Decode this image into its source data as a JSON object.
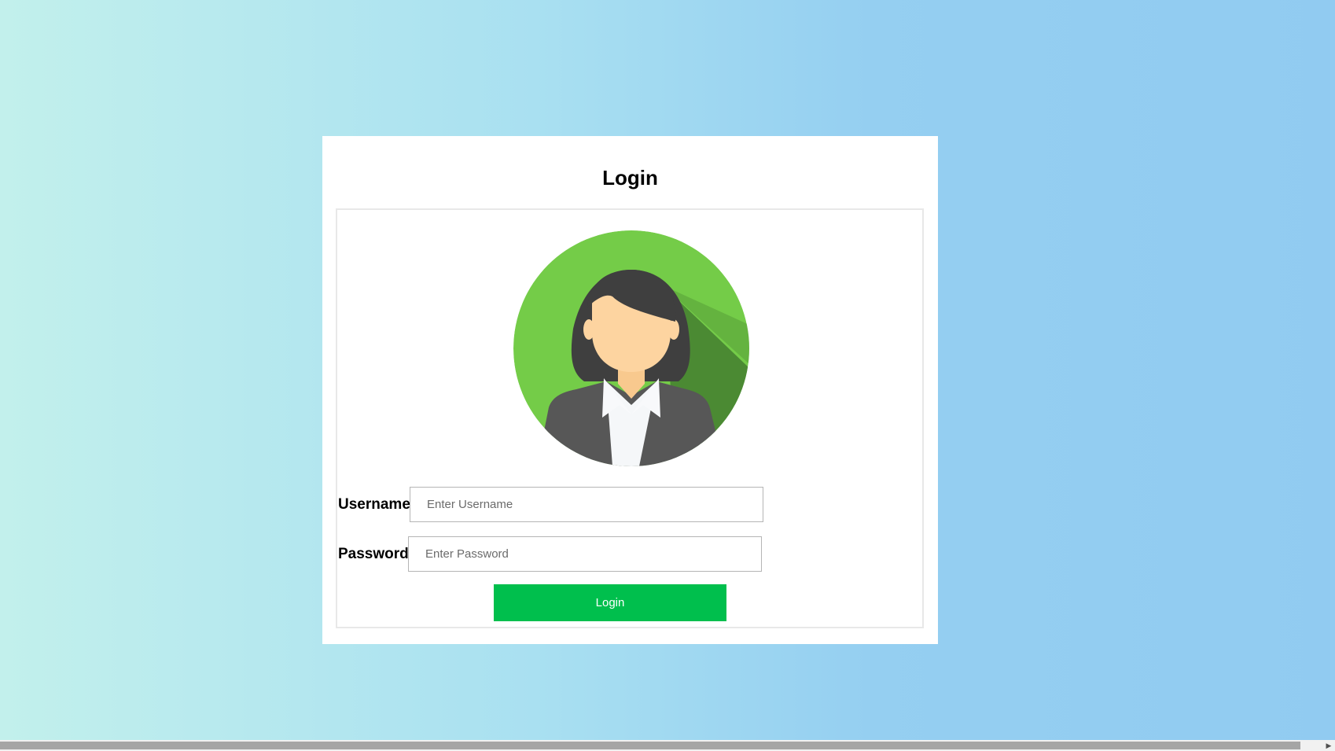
{
  "login_card": {
    "title": "Login",
    "avatar_icon": "female-user-avatar-icon",
    "username_label": "Username",
    "username_placeholder": "Enter Username",
    "username_value": "",
    "password_label": "Password",
    "password_placeholder": "Enter Password",
    "password_value": "",
    "submit_label": "Login"
  },
  "colors": {
    "background_gradient_start": "#c2f0ec",
    "background_gradient_end": "#91cbf1",
    "card_background": "#ffffff",
    "avatar_circle": "#74cc48",
    "button_background": "#00bf4d",
    "button_text": "#ffffff"
  },
  "scrollbar": {
    "orientation": "horizontal",
    "arrow_icon": "triangle-right-icon"
  }
}
